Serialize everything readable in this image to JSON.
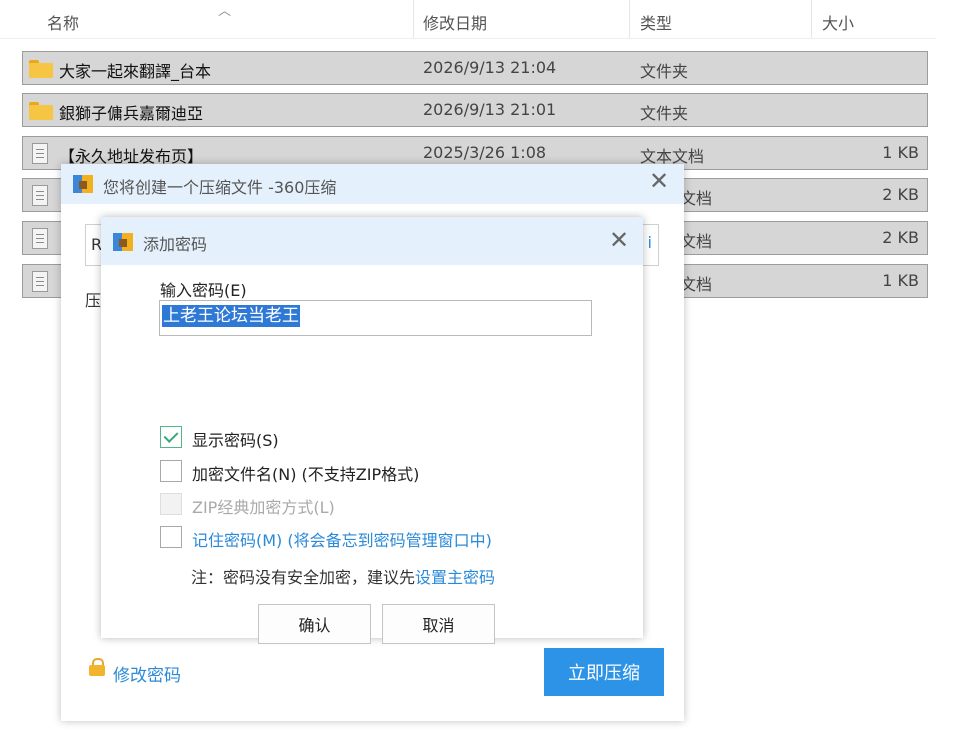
{
  "columns": {
    "name": "名称",
    "modified": "修改日期",
    "type": "类型",
    "size": "大小"
  },
  "files": [
    {
      "name": "大家一起來翻譯_台本",
      "modified": "2026/9/13 21:04",
      "type": "文件夹",
      "size": "",
      "icon": "folder-icon"
    },
    {
      "name": "銀獅子傭兵嘉爾迪亞",
      "modified": "2026/9/13 21:01",
      "type": "文件夹",
      "size": "",
      "icon": "folder-icon"
    },
    {
      "name": "【永久地址发布页】",
      "modified": "2025/3/26 1:08",
      "type": "文本文档",
      "size": "1 KB",
      "icon": "text-file-icon"
    },
    {
      "name": "",
      "modified": "",
      "type": "文档",
      "size": "2 KB",
      "icon": "text-file-icon"
    },
    {
      "name": "",
      "modified": "",
      "type": "文档",
      "size": "2 KB",
      "icon": "text-file-icon"
    },
    {
      "name": "",
      "modified": "",
      "type": "文档",
      "size": "1 KB",
      "icon": "text-file-icon"
    }
  ],
  "outer_dialog": {
    "title": "您将创建一个压缩文件 -360压缩",
    "field_fragment": "R",
    "field_fragment_right": "i",
    "label_fragment": "压",
    "modify_password": "修改密码",
    "compress_now": "立即压缩"
  },
  "password_dialog": {
    "title": "添加密码",
    "input_label": "输入密码(E)",
    "password_value": "上老王论坛当老王",
    "options": [
      {
        "label": "显示密码(S)",
        "checked": true,
        "disabled": false,
        "style": "normal"
      },
      {
        "label": "加密文件名(N) (不支持ZIP格式)",
        "checked": false,
        "disabled": false,
        "style": "normal"
      },
      {
        "label": "ZIP经典加密方式(L)",
        "checked": false,
        "disabled": true,
        "style": "disabled"
      },
      {
        "label": "记住密码(M) (将会备忘到密码管理窗口中)",
        "checked": false,
        "disabled": false,
        "style": "blue"
      }
    ],
    "note_prefix": "注：密码没有安全加密，建议先",
    "note_link": "设置主密码",
    "ok": "确认",
    "cancel": "取消"
  },
  "colors": {
    "accent": "#2c93e6",
    "titlebar": "#e4f0fb",
    "selection": "#2f79d6",
    "row_selected": "#d6d6d6"
  }
}
